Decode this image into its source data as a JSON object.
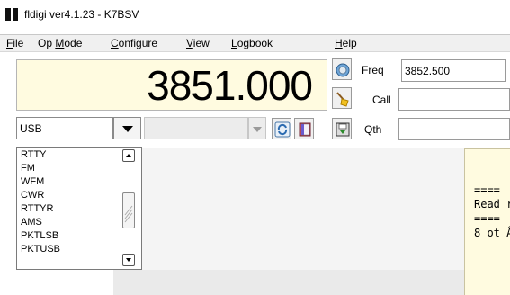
{
  "window": {
    "title": "fldigi ver4.1.23 - K7BSV"
  },
  "menu": [
    {
      "label": "File",
      "u": "F",
      "rest": "ile"
    },
    {
      "label": "Op Mode",
      "u": "",
      "rest": "Op ",
      "u2": "M",
      "rest2": "ode"
    },
    {
      "label": "Configure",
      "u": "C",
      "rest": "onfigure"
    },
    {
      "label": "View",
      "u": "V",
      "rest": "iew"
    },
    {
      "label": "Logbook",
      "u": "L",
      "rest": "ogbook"
    },
    {
      "label": "Help",
      "u": "H",
      "rest": "elp"
    }
  ],
  "frequency_display": "3851.000",
  "mode": {
    "selected": "USB"
  },
  "mode_options": [
    "RTTY",
    "FM",
    "WFM",
    "CWR",
    "RTTYR",
    "AMS",
    "PKTLSB",
    "PKTUSB"
  ],
  "qso": {
    "freq_label": "Freq",
    "freq_value": "3852.500",
    "call_label": "Call",
    "call_value": "",
    "qth_label": "Qth",
    "qth_value": ""
  },
  "rx_text": [
    "====",
    "Read r",
    "====",
    "8 ot Â"
  ],
  "icons": {
    "globe": "globe-icon",
    "sweep": "broom-icon",
    "save": "save-icon",
    "refresh": "refresh-icon",
    "book": "book-icon"
  },
  "colors": {
    "freq_background": "#fffbe0",
    "rx_background": "#fffbe0",
    "menu_background": "#f0f0f0"
  }
}
